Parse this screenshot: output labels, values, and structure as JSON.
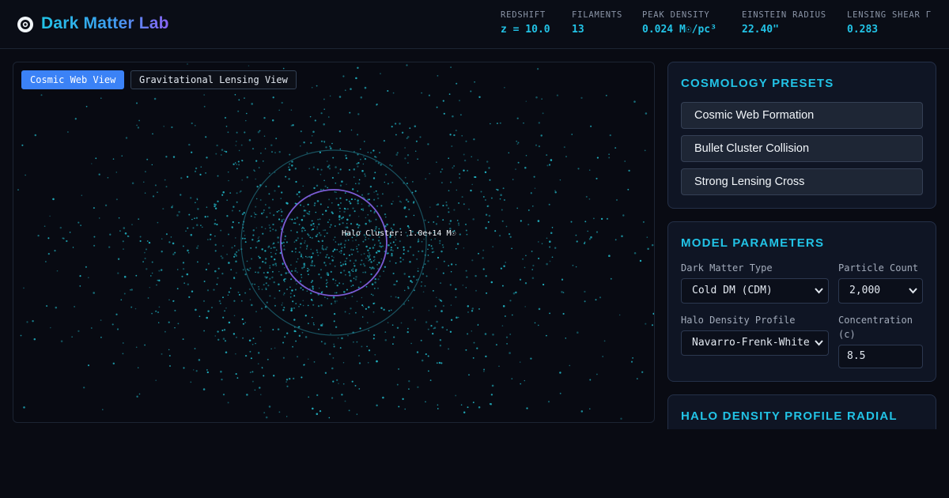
{
  "app": {
    "title": "Dark Matter Lab"
  },
  "stats": [
    {
      "label": "Redshift",
      "value": "z = 10.0"
    },
    {
      "label": "Filaments",
      "value": "13"
    },
    {
      "label": "Peak Density",
      "value": "0.024 M☉/pc³"
    },
    {
      "label": "Einstein Radius",
      "value": "22.40\""
    },
    {
      "label": "Lensing Shear Γ",
      "value": "0.283"
    }
  ],
  "viz": {
    "tabs": [
      {
        "label": "Cosmic Web View",
        "active": true
      },
      {
        "label": "Gravitational Lensing View",
        "active": false
      }
    ],
    "halo_label": "Halo Cluster: 1.0e+14 M☉",
    "particle_color": "#22b8c8",
    "einstein_ring_color": "#7c5cd6"
  },
  "presets": {
    "title": "Cosmology Presets",
    "items": [
      "Cosmic Web Formation",
      "Bullet Cluster Collision",
      "Strong Lensing Cross"
    ]
  },
  "model": {
    "title": "Model Parameters",
    "dark_matter_type": {
      "label": "Dark Matter Type",
      "value": "Cold DM (CDM)"
    },
    "particle_count": {
      "label": "Particle Count",
      "value": "2,000"
    },
    "halo_profile": {
      "label": "Halo Density Profile",
      "value": "Navarro-Frenk-White"
    },
    "concentration": {
      "label": "Concentration (c)",
      "value": "8.5"
    }
  },
  "radial": {
    "title": "Halo Density Profile Radial"
  }
}
